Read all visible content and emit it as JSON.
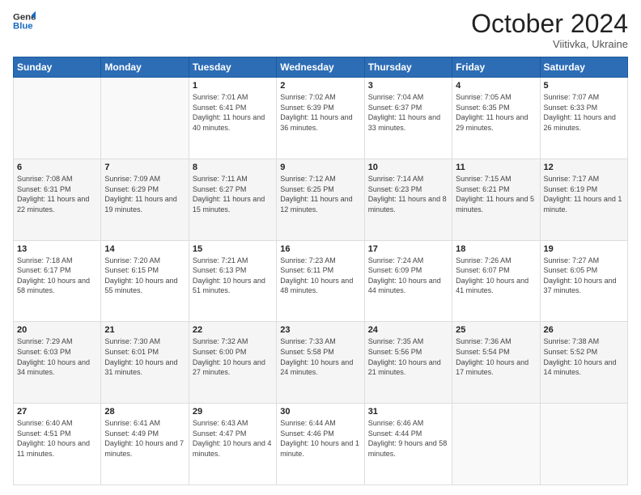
{
  "header": {
    "logo_line1": "General",
    "logo_line2": "Blue",
    "month": "October 2024",
    "location": "Viitivka, Ukraine"
  },
  "days_of_week": [
    "Sunday",
    "Monday",
    "Tuesday",
    "Wednesday",
    "Thursday",
    "Friday",
    "Saturday"
  ],
  "weeks": [
    [
      {
        "day": "",
        "sunrise": "",
        "sunset": "",
        "daylight": ""
      },
      {
        "day": "",
        "sunrise": "",
        "sunset": "",
        "daylight": ""
      },
      {
        "day": "1",
        "sunrise": "Sunrise: 7:01 AM",
        "sunset": "Sunset: 6:41 PM",
        "daylight": "Daylight: 11 hours and 40 minutes."
      },
      {
        "day": "2",
        "sunrise": "Sunrise: 7:02 AM",
        "sunset": "Sunset: 6:39 PM",
        "daylight": "Daylight: 11 hours and 36 minutes."
      },
      {
        "day": "3",
        "sunrise": "Sunrise: 7:04 AM",
        "sunset": "Sunset: 6:37 PM",
        "daylight": "Daylight: 11 hours and 33 minutes."
      },
      {
        "day": "4",
        "sunrise": "Sunrise: 7:05 AM",
        "sunset": "Sunset: 6:35 PM",
        "daylight": "Daylight: 11 hours and 29 minutes."
      },
      {
        "day": "5",
        "sunrise": "Sunrise: 7:07 AM",
        "sunset": "Sunset: 6:33 PM",
        "daylight": "Daylight: 11 hours and 26 minutes."
      }
    ],
    [
      {
        "day": "6",
        "sunrise": "Sunrise: 7:08 AM",
        "sunset": "Sunset: 6:31 PM",
        "daylight": "Daylight: 11 hours and 22 minutes."
      },
      {
        "day": "7",
        "sunrise": "Sunrise: 7:09 AM",
        "sunset": "Sunset: 6:29 PM",
        "daylight": "Daylight: 11 hours and 19 minutes."
      },
      {
        "day": "8",
        "sunrise": "Sunrise: 7:11 AM",
        "sunset": "Sunset: 6:27 PM",
        "daylight": "Daylight: 11 hours and 15 minutes."
      },
      {
        "day": "9",
        "sunrise": "Sunrise: 7:12 AM",
        "sunset": "Sunset: 6:25 PM",
        "daylight": "Daylight: 11 hours and 12 minutes."
      },
      {
        "day": "10",
        "sunrise": "Sunrise: 7:14 AM",
        "sunset": "Sunset: 6:23 PM",
        "daylight": "Daylight: 11 hours and 8 minutes."
      },
      {
        "day": "11",
        "sunrise": "Sunrise: 7:15 AM",
        "sunset": "Sunset: 6:21 PM",
        "daylight": "Daylight: 11 hours and 5 minutes."
      },
      {
        "day": "12",
        "sunrise": "Sunrise: 7:17 AM",
        "sunset": "Sunset: 6:19 PM",
        "daylight": "Daylight: 11 hours and 1 minute."
      }
    ],
    [
      {
        "day": "13",
        "sunrise": "Sunrise: 7:18 AM",
        "sunset": "Sunset: 6:17 PM",
        "daylight": "Daylight: 10 hours and 58 minutes."
      },
      {
        "day": "14",
        "sunrise": "Sunrise: 7:20 AM",
        "sunset": "Sunset: 6:15 PM",
        "daylight": "Daylight: 10 hours and 55 minutes."
      },
      {
        "day": "15",
        "sunrise": "Sunrise: 7:21 AM",
        "sunset": "Sunset: 6:13 PM",
        "daylight": "Daylight: 10 hours and 51 minutes."
      },
      {
        "day": "16",
        "sunrise": "Sunrise: 7:23 AM",
        "sunset": "Sunset: 6:11 PM",
        "daylight": "Daylight: 10 hours and 48 minutes."
      },
      {
        "day": "17",
        "sunrise": "Sunrise: 7:24 AM",
        "sunset": "Sunset: 6:09 PM",
        "daylight": "Daylight: 10 hours and 44 minutes."
      },
      {
        "day": "18",
        "sunrise": "Sunrise: 7:26 AM",
        "sunset": "Sunset: 6:07 PM",
        "daylight": "Daylight: 10 hours and 41 minutes."
      },
      {
        "day": "19",
        "sunrise": "Sunrise: 7:27 AM",
        "sunset": "Sunset: 6:05 PM",
        "daylight": "Daylight: 10 hours and 37 minutes."
      }
    ],
    [
      {
        "day": "20",
        "sunrise": "Sunrise: 7:29 AM",
        "sunset": "Sunset: 6:03 PM",
        "daylight": "Daylight: 10 hours and 34 minutes."
      },
      {
        "day": "21",
        "sunrise": "Sunrise: 7:30 AM",
        "sunset": "Sunset: 6:01 PM",
        "daylight": "Daylight: 10 hours and 31 minutes."
      },
      {
        "day": "22",
        "sunrise": "Sunrise: 7:32 AM",
        "sunset": "Sunset: 6:00 PM",
        "daylight": "Daylight: 10 hours and 27 minutes."
      },
      {
        "day": "23",
        "sunrise": "Sunrise: 7:33 AM",
        "sunset": "Sunset: 5:58 PM",
        "daylight": "Daylight: 10 hours and 24 minutes."
      },
      {
        "day": "24",
        "sunrise": "Sunrise: 7:35 AM",
        "sunset": "Sunset: 5:56 PM",
        "daylight": "Daylight: 10 hours and 21 minutes."
      },
      {
        "day": "25",
        "sunrise": "Sunrise: 7:36 AM",
        "sunset": "Sunset: 5:54 PM",
        "daylight": "Daylight: 10 hours and 17 minutes."
      },
      {
        "day": "26",
        "sunrise": "Sunrise: 7:38 AM",
        "sunset": "Sunset: 5:52 PM",
        "daylight": "Daylight: 10 hours and 14 minutes."
      }
    ],
    [
      {
        "day": "27",
        "sunrise": "Sunrise: 6:40 AM",
        "sunset": "Sunset: 4:51 PM",
        "daylight": "Daylight: 10 hours and 11 minutes."
      },
      {
        "day": "28",
        "sunrise": "Sunrise: 6:41 AM",
        "sunset": "Sunset: 4:49 PM",
        "daylight": "Daylight: 10 hours and 7 minutes."
      },
      {
        "day": "29",
        "sunrise": "Sunrise: 6:43 AM",
        "sunset": "Sunset: 4:47 PM",
        "daylight": "Daylight: 10 hours and 4 minutes."
      },
      {
        "day": "30",
        "sunrise": "Sunrise: 6:44 AM",
        "sunset": "Sunset: 4:46 PM",
        "daylight": "Daylight: 10 hours and 1 minute."
      },
      {
        "day": "31",
        "sunrise": "Sunrise: 6:46 AM",
        "sunset": "Sunset: 4:44 PM",
        "daylight": "Daylight: 9 hours and 58 minutes."
      },
      {
        "day": "",
        "sunrise": "",
        "sunset": "",
        "daylight": ""
      },
      {
        "day": "",
        "sunrise": "",
        "sunset": "",
        "daylight": ""
      }
    ]
  ]
}
